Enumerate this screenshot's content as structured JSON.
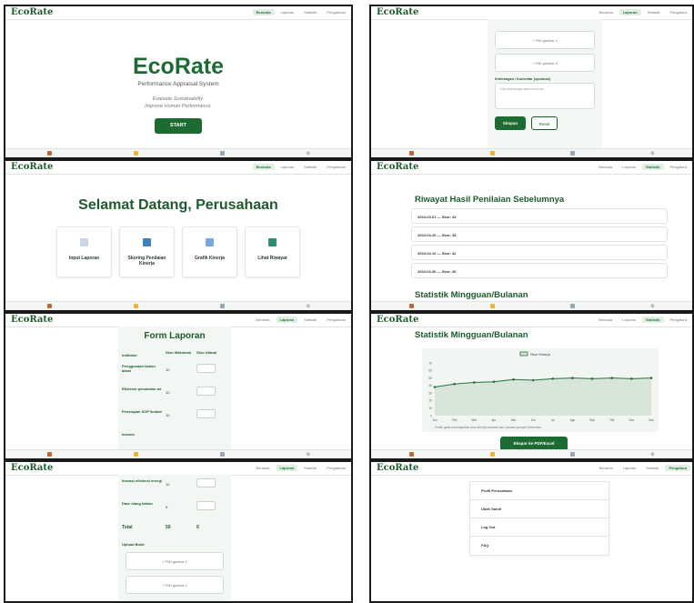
{
  "brand": "EcoRate",
  "nav": {
    "home": "Beranda",
    "reports": "Laporan",
    "stats": "Statistik",
    "settings": "Pengaturan",
    "settings_cut": "Pengatura"
  },
  "bottom_bar": {
    "icons": [
      "home-icon",
      "folder-icon",
      "chart-icon",
      "gear-icon"
    ]
  },
  "landing": {
    "title": "EcoRate",
    "subtitle": "Performance Appraisal System",
    "tagline_1": "Evaluate Sustainability.",
    "tagline_2": "Improve Human Performance.",
    "start": "START"
  },
  "dashboard": {
    "welcome": "Selamat Datang, Perusahaan",
    "cards": [
      {
        "label": "Input Laporan",
        "icon": "document-icon",
        "color": "#c9d6e8"
      },
      {
        "label": "Skoring Penilaian Kinerja",
        "icon": "bar-chart-icon",
        "color": "#3f7fbf"
      },
      {
        "label": "Grafik Kinerja",
        "icon": "line-chart-icon",
        "color": "#7aa6d9"
      },
      {
        "label": "Lihat Riwayat",
        "icon": "book-icon",
        "color": "#2f8f6a"
      }
    ]
  },
  "form": {
    "title": "Form Laporan",
    "col_indicator": "Indikator",
    "col_max": "Skor Maksimal",
    "col_actual": "Skor Aktual",
    "rows": [
      {
        "indicator": "Penggunaan bahan alami",
        "max": "10"
      },
      {
        "indicator": "Efisiensi penukaian air",
        "max": "10"
      },
      {
        "indicator": "Penerapan SOP limbah",
        "max": "10"
      },
      {
        "indicator": "Inovasi",
        "max": ""
      }
    ],
    "rows_cont": [
      {
        "indicator": "Inovasi efisiensi energi",
        "max": "10"
      },
      {
        "indicator": "Daur ulang bahan",
        "max": "5"
      }
    ],
    "total_label": "Total",
    "total_max": "50",
    "total_actual": "0",
    "upload_label": "Upload Bukti",
    "upload_1": "+ Pilih gambar 1",
    "upload_2": "+ Pilih gambar 2",
    "upload_3": "+ Pilih gambar 3",
    "comment_label": "Keterangan / Komentar (opsional)",
    "comment_placeholder": "Tulis keterangan atau komentar",
    "save": "Simpan",
    "reset": "Reset"
  },
  "history": {
    "title": "Riwayat Hasil Penilaian Sebelumnya",
    "items": [
      "2024-03-01 — Skor: 43",
      "2024-04-20 — Skor: 38",
      "2024-04-10 — Skor: 42",
      "2024-03-30 — Skor: 40"
    ],
    "next_title": "Statistik Mingguan/Bulanan"
  },
  "stats": {
    "title": "Statistik Mingguan/Bulanan",
    "caption": "Grafik garis menunjukkan skor kinerja bulanan dari Januari sampai Desember.",
    "export": "Ekspor ke PDF/Excel"
  },
  "chart_data": {
    "type": "line",
    "legend": "Skor Kinerja",
    "legend_position": "top",
    "categories": [
      "Jan",
      "Feb",
      "Mar",
      "Apr",
      "Mei",
      "Jun",
      "Jul",
      "Agu",
      "Sep",
      "Okt",
      "Nov",
      "Des"
    ],
    "series": [
      {
        "name": "Skor Kinerja",
        "values": [
          38,
          42,
          44,
          45,
          48,
          47,
          49,
          50,
          49,
          50,
          49,
          50
        ]
      }
    ],
    "y_ticks": [
      "0",
      "10",
      "20",
      "30",
      "40",
      "50",
      "60",
      "70"
    ],
    "ylim": [
      0,
      70
    ],
    "grid": false,
    "line_color": "#2e6e3e",
    "fill_color": "#d8e6d9"
  },
  "settings": {
    "items": [
      "Profil Perusahaan",
      "Ubah Sandi",
      "Log Out",
      "FAQ"
    ]
  },
  "colors": {
    "primary": "#1d6a33",
    "active_bg": "#e2eee4",
    "form_bg": "#f3f7f3"
  }
}
